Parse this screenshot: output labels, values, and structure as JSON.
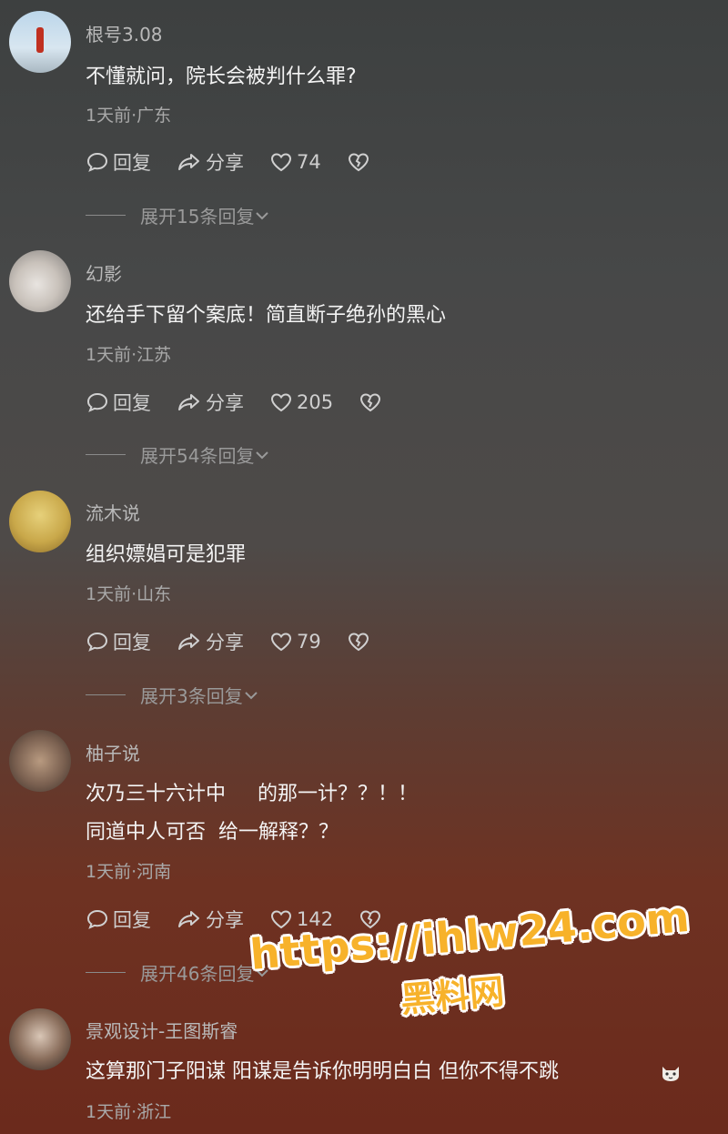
{
  "comments": [
    {
      "user": "根号3.08",
      "lines": [
        "不懂就问，院长会被判什么罪?"
      ],
      "meta": "1天前·广东",
      "reply": "回复",
      "share": "分享",
      "likes": "74",
      "expand": "展开15条回复"
    },
    {
      "user": "幻影",
      "lines": [
        "还给手下留个案底！简直断子绝孙的黑心"
      ],
      "meta": "1天前·江苏",
      "reply": "回复",
      "share": "分享",
      "likes": "205",
      "expand": "展开54条回复"
    },
    {
      "user": "流木说",
      "lines": [
        "组织嫖娼可是犯罪"
      ],
      "meta": "1天前·山东",
      "reply": "回复",
      "share": "分享",
      "likes": "79",
      "expand": "展开3条回复"
    },
    {
      "user": "柚子说",
      "lines": [
        "次乃三十六计中     的那一计？？！！",
        "同道中人可否  给一解释？？"
      ],
      "meta": "1天前·河南",
      "reply": "回复",
      "share": "分享",
      "likes": "142",
      "expand": "展开46条回复"
    },
    {
      "user": "景观设计-王图斯睿",
      "lines": [
        "这算那门子阳谋 阳谋是告诉你明明白白 但你不得不跳"
      ],
      "meta": "1天前·浙江"
    }
  ],
  "watermark": {
    "url": "https://ihlw24.com",
    "name": "黑料网"
  },
  "icons": {
    "reply": "comment-bubble-icon",
    "share": "share-arrow-icon",
    "like": "heart-icon",
    "dislike": "broken-heart-icon",
    "emoji": "cat-emoji-icon"
  }
}
